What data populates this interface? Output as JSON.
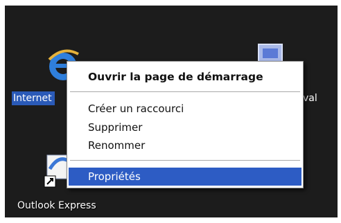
{
  "desktop": {
    "icons": [
      {
        "label": "Internet",
        "icon": "internet-explorer-icon"
      },
      {
        "label": "Outlook Express",
        "icon": "outlook-express-icon"
      },
      {
        "label_visible_tail": "val",
        "icon": "computer-icon"
      }
    ]
  },
  "context_menu": {
    "items": [
      {
        "label": "Ouvrir la page de démarrage",
        "bold": true
      },
      {
        "label": "Créer un raccourci"
      },
      {
        "label": "Supprimer"
      },
      {
        "label": "Renommer"
      },
      {
        "label": "Propriétés",
        "selected": true
      }
    ]
  },
  "colors": {
    "desktop_bg": "#1c1c1c",
    "selection": "#2d5cc4",
    "menu_bg": "#ffffff"
  }
}
